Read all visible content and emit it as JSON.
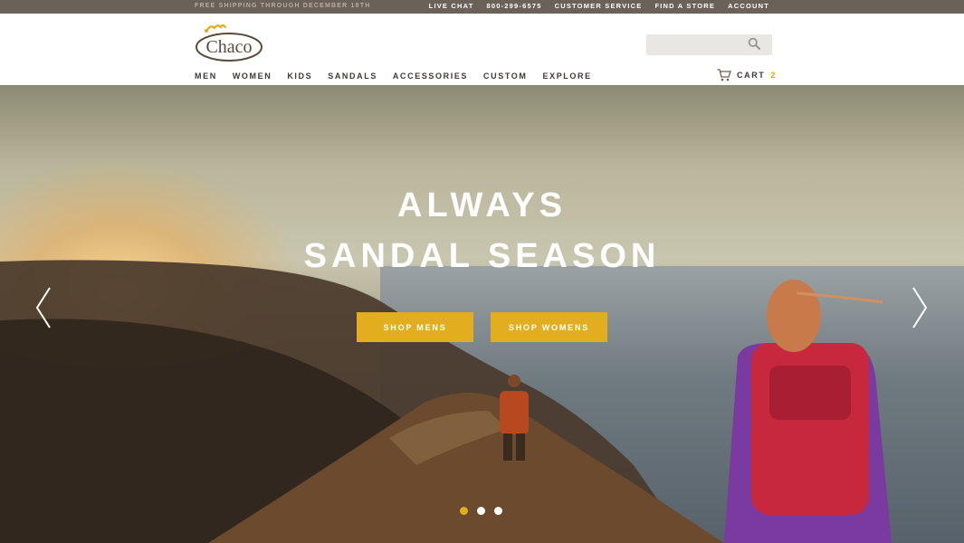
{
  "topbar": {
    "promo": "FREE SHIPPING THROUGH DECEMBER 18TH",
    "links": [
      "LIVE CHAT",
      "800-299-6575",
      "CUSTOMER SERVICE",
      "FIND A STORE",
      "ACCOUNT"
    ]
  },
  "brand": {
    "logo_text": "Chaco",
    "accent": "#e2ad1f"
  },
  "search": {
    "placeholder": "",
    "icon": "search-icon"
  },
  "nav": {
    "items": [
      "MEN",
      "WOMEN",
      "KIDS",
      "SANDALS",
      "ACCESSORIES",
      "CUSTOM",
      "EXPLORE"
    ]
  },
  "cart": {
    "label": "CART",
    "count": "2",
    "icon": "cart-icon"
  },
  "hero": {
    "headline_line1": "ALWAYS",
    "headline_line2": "SANDAL SEASON",
    "cta_mens": "SHOP MENS",
    "cta_womens": "SHOP WOMENS",
    "slides": 3,
    "active_slide": 1
  }
}
